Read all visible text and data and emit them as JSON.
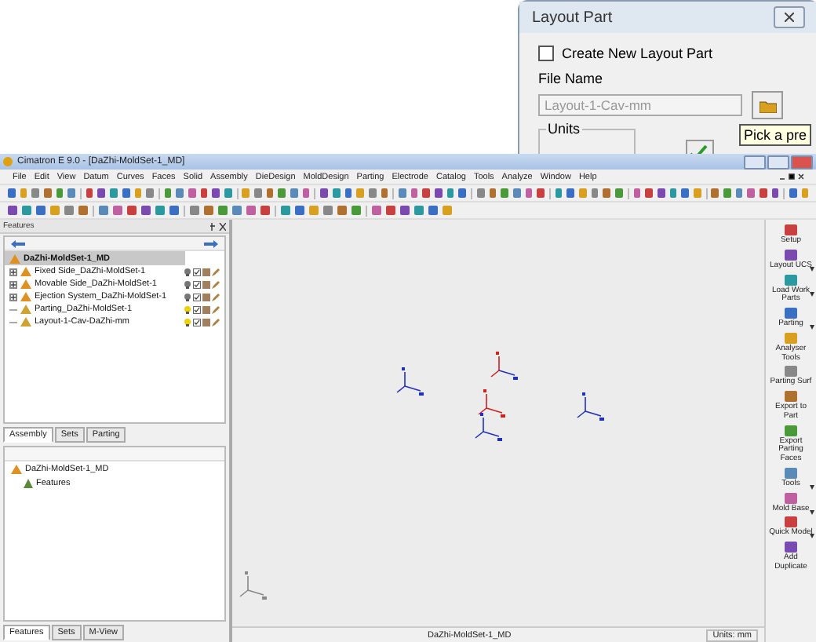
{
  "dialog": {
    "title": "Layout Part",
    "create_new": {
      "label": "Create New Layout Part",
      "checked": false
    },
    "file_name_label": "File Name",
    "file_name": {
      "value": "Layout-1-Cav-mm",
      "disabled": true
    },
    "tooltip": "Pick a pre",
    "units_label": "Units"
  },
  "window": {
    "title": "Cimatron E 9.0 - [DaZhi-MoldSet-1_MD]"
  },
  "menu": [
    "File",
    "Edit",
    "View",
    "Datum",
    "Curves",
    "Faces",
    "Solid",
    "Assembly",
    "DieDesign",
    "MoldDesign",
    "Parting",
    "Electrode",
    "Catalog",
    "Tools",
    "Analyze",
    "Window",
    "Help"
  ],
  "features_panel": {
    "title": "Features",
    "root": {
      "label": "DaZhi-MoldSet-1_MD",
      "selected": true
    },
    "items": [
      {
        "label": "Fixed Side_DaZhi-MoldSet-1",
        "expander": true,
        "light_on": false
      },
      {
        "label": "Movable Side_DaZhi-MoldSet-1",
        "expander": true,
        "light_on": false
      },
      {
        "label": "Ejection System_DaZhi-MoldSet-1",
        "expander": true,
        "light_on": false
      },
      {
        "label": "Parting_DaZhi-MoldSet-1",
        "expander": false,
        "light_on": true
      },
      {
        "label": "Layout-1-Cav-DaZhi-mm",
        "expander": false,
        "light_on": true
      }
    ],
    "tabs": [
      {
        "label": "Assembly",
        "selected": true
      },
      {
        "label": "Sets",
        "selected": false
      },
      {
        "label": "Parting",
        "selected": false
      }
    ]
  },
  "lower_panel": {
    "root": "DaZhi-MoldSet-1_MD",
    "child": "Features",
    "tabs": [
      {
        "label": "Features",
        "selected": true
      },
      {
        "label": "Sets",
        "selected": false
      },
      {
        "label": "M-View",
        "selected": false
      }
    ]
  },
  "right_toolbar": [
    {
      "label": "Setup",
      "dropdown": false
    },
    {
      "label": "Layout UCS",
      "dropdown": true
    },
    {
      "label": "Load Work Parts",
      "dropdown": true
    },
    {
      "label": "Parting",
      "dropdown": true
    },
    {
      "label": "Analyser Tools",
      "dropdown": false
    },
    {
      "label": "Parting Surf",
      "dropdown": false
    },
    {
      "label": "Export to Part",
      "dropdown": false
    },
    {
      "label": "Export Parting Faces",
      "dropdown": false
    },
    {
      "label": "Tools",
      "dropdown": true
    },
    {
      "label": "Mold Base",
      "dropdown": true
    },
    {
      "label": "Quick Model",
      "dropdown": true
    },
    {
      "label": "Add Duplicate",
      "dropdown": false
    }
  ],
  "status_bar": {
    "document": "DaZhi-MoldSet-1_MD",
    "units": "Units: mm"
  }
}
